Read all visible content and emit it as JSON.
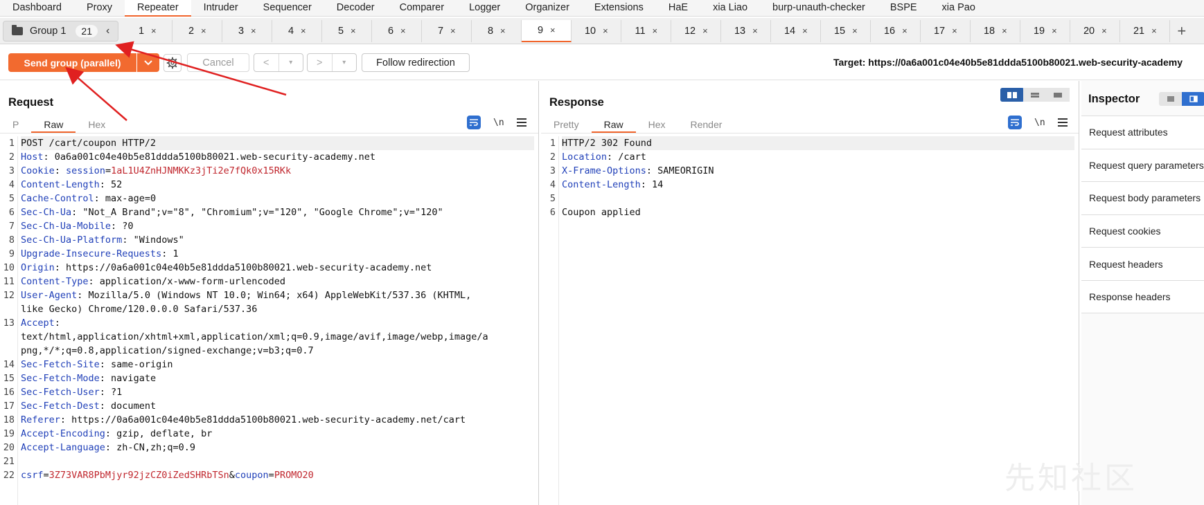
{
  "top_tabs": [
    "Dashboard",
    "Proxy",
    "Repeater",
    "Intruder",
    "Sequencer",
    "Decoder",
    "Comparer",
    "Logger",
    "Organizer",
    "Extensions",
    "HaE",
    "xia Liao",
    "burp-unauth-checker",
    "BSPE",
    "xia Pao"
  ],
  "top_active": "Repeater",
  "group": {
    "name": "Group 1",
    "count": "21",
    "chevron": "‹"
  },
  "request_tabs": [
    "1",
    "2",
    "3",
    "4",
    "5",
    "6",
    "7",
    "8",
    "9",
    "10",
    "11",
    "12",
    "13",
    "14",
    "15",
    "16",
    "17",
    "18",
    "19",
    "20",
    "21"
  ],
  "active_request_tab": "9",
  "tab_close": "×",
  "add_tab": "+",
  "toolbar": {
    "send_label": "Send group (parallel)",
    "cancel_label": "Cancel",
    "back_label": "<",
    "forward_label": ">",
    "dropdown_glyph": "▾",
    "follow_label": "Follow redirection",
    "target": "Target: https://0a6a001c04e40b5e81ddda5100b80021.web-security-academy"
  },
  "request": {
    "title": "Request",
    "tabs": [
      "P",
      "Raw",
      "Hex"
    ],
    "active_tab": "Raw",
    "newline_label": "\\n",
    "lines": [
      {
        "n": "1",
        "segs": [
          [
            "",
            "POST /cart/coupon HTTP/2"
          ]
        ]
      },
      {
        "n": "2",
        "segs": [
          [
            "hk",
            "Host"
          ],
          [
            "",
            ": 0a6a001c04e40b5e81ddda5100b80021.web-security-academy.net"
          ]
        ]
      },
      {
        "n": "3",
        "segs": [
          [
            "hk",
            "Cookie"
          ],
          [
            "",
            ": "
          ],
          [
            "pk",
            "session"
          ],
          [
            "",
            "="
          ],
          [
            "pv",
            "1aL1U4ZnHJNMKKz3jTi2e7fQk0x15RKk"
          ]
        ]
      },
      {
        "n": "4",
        "segs": [
          [
            "hk",
            "Content-Length"
          ],
          [
            "",
            ": 52"
          ]
        ]
      },
      {
        "n": "5",
        "segs": [
          [
            "hk",
            "Cache-Control"
          ],
          [
            "",
            ": max-age=0"
          ]
        ]
      },
      {
        "n": "6",
        "segs": [
          [
            "hk",
            "Sec-Ch-Ua"
          ],
          [
            "",
            ": \"Not_A Brand\";v=\"8\", \"Chromium\";v=\"120\", \"Google Chrome\";v=\"120\""
          ]
        ]
      },
      {
        "n": "7",
        "segs": [
          [
            "hk",
            "Sec-Ch-Ua-Mobile"
          ],
          [
            "",
            ": ?0"
          ]
        ]
      },
      {
        "n": "8",
        "segs": [
          [
            "hk",
            "Sec-Ch-Ua-Platform"
          ],
          [
            "",
            ": \"Windows\""
          ]
        ]
      },
      {
        "n": "9",
        "segs": [
          [
            "hk",
            "Upgrade-Insecure-Requests"
          ],
          [
            "",
            ": 1"
          ]
        ]
      },
      {
        "n": "10",
        "segs": [
          [
            "hk",
            "Origin"
          ],
          [
            "",
            ": https://0a6a001c04e40b5e81ddda5100b80021.web-security-academy.net"
          ]
        ]
      },
      {
        "n": "11",
        "segs": [
          [
            "hk",
            "Content-Type"
          ],
          [
            "",
            ": application/x-www-form-urlencoded"
          ]
        ]
      },
      {
        "n": "12",
        "segs": [
          [
            "hk",
            "User-Agent"
          ],
          [
            "",
            ": Mozilla/5.0 (Windows NT 10.0; Win64; x64) AppleWebKit/537.36 (KHTML,"
          ]
        ]
      },
      {
        "n": "",
        "segs": [
          [
            "",
            "like Gecko) Chrome/120.0.0.0 Safari/537.36"
          ]
        ]
      },
      {
        "n": "13",
        "segs": [
          [
            "hk",
            "Accept"
          ],
          [
            "",
            ":"
          ]
        ]
      },
      {
        "n": "",
        "segs": [
          [
            "",
            "text/html,application/xhtml+xml,application/xml;q=0.9,image/avif,image/webp,image/a"
          ]
        ]
      },
      {
        "n": "",
        "segs": [
          [
            "",
            "png,*/*;q=0.8,application/signed-exchange;v=b3;q=0.7"
          ]
        ]
      },
      {
        "n": "14",
        "segs": [
          [
            "hk",
            "Sec-Fetch-Site"
          ],
          [
            "",
            ": same-origin"
          ]
        ]
      },
      {
        "n": "15",
        "segs": [
          [
            "hk",
            "Sec-Fetch-Mode"
          ],
          [
            "",
            ": navigate"
          ]
        ]
      },
      {
        "n": "16",
        "segs": [
          [
            "hk",
            "Sec-Fetch-User"
          ],
          [
            "",
            ": ?1"
          ]
        ]
      },
      {
        "n": "17",
        "segs": [
          [
            "hk",
            "Sec-Fetch-Dest"
          ],
          [
            "",
            ": document"
          ]
        ]
      },
      {
        "n": "18",
        "segs": [
          [
            "hk",
            "Referer"
          ],
          [
            "",
            ": https://0a6a001c04e40b5e81ddda5100b80021.web-security-academy.net/cart"
          ]
        ]
      },
      {
        "n": "19",
        "segs": [
          [
            "hk",
            "Accept-Encoding"
          ],
          [
            "",
            ": gzip, deflate, br"
          ]
        ]
      },
      {
        "n": "20",
        "segs": [
          [
            "hk",
            "Accept-Language"
          ],
          [
            "",
            ": zh-CN,zh;q=0.9"
          ]
        ]
      },
      {
        "n": "21",
        "segs": [
          [
            "",
            ""
          ]
        ]
      },
      {
        "n": "22",
        "segs": [
          [
            "pk",
            "csrf"
          ],
          [
            "",
            "="
          ],
          [
            "pv",
            "3Z73VAR8PbMjyr92jzCZ0iZedSHRbTSn"
          ],
          [
            "",
            "&"
          ],
          [
            "pk",
            "coupon"
          ],
          [
            "",
            "="
          ],
          [
            "pv",
            "PROMO20"
          ]
        ]
      }
    ]
  },
  "response": {
    "title": "Response",
    "tabs": [
      "Pretty",
      "Raw",
      "Hex",
      "Render"
    ],
    "active_tab": "Raw",
    "newline_label": "\\n",
    "lines": [
      {
        "n": "1",
        "segs": [
          [
            "",
            "HTTP/2 302 Found"
          ]
        ]
      },
      {
        "n": "2",
        "segs": [
          [
            "hk",
            "Location"
          ],
          [
            "",
            ": /cart"
          ]
        ]
      },
      {
        "n": "3",
        "segs": [
          [
            "hk",
            "X-Frame-Options"
          ],
          [
            "",
            ": SAMEORIGIN"
          ]
        ]
      },
      {
        "n": "4",
        "segs": [
          [
            "hk",
            "Content-Length"
          ],
          [
            "",
            ": 14"
          ]
        ]
      },
      {
        "n": "5",
        "segs": [
          [
            "",
            ""
          ]
        ]
      },
      {
        "n": "6",
        "segs": [
          [
            "",
            "Coupon applied"
          ]
        ]
      }
    ]
  },
  "inspector": {
    "title": "Inspector",
    "items": [
      "Request attributes",
      "Request query parameters",
      "Request body parameters",
      "Request cookies",
      "Request headers",
      "Response headers"
    ]
  },
  "watermark": "先知社区",
  "colors": {
    "accent": "#f26a2f",
    "header_key": "#1f3fb8",
    "param_value": "#c0262d",
    "annotation": "#e02020",
    "toggle_blue": "#3a7bd5"
  }
}
